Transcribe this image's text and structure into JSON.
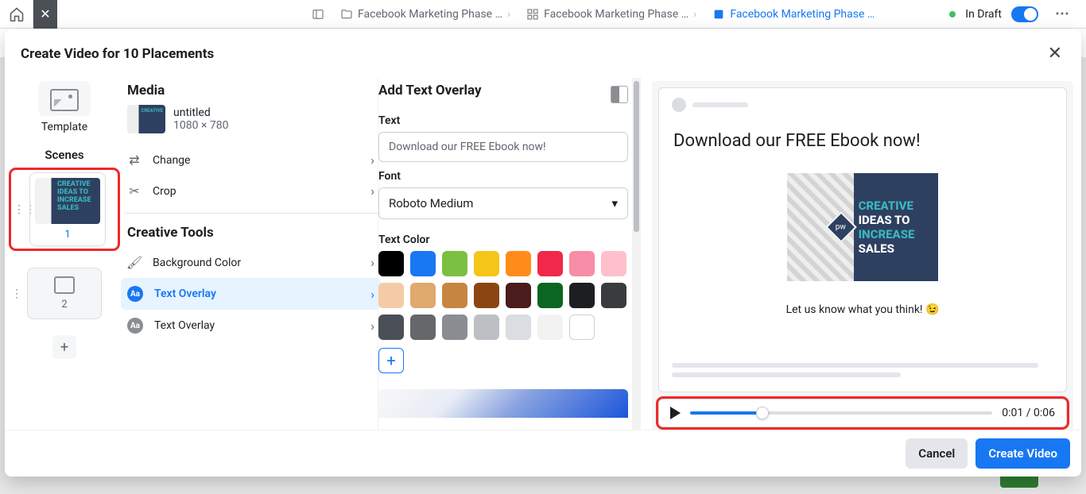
{
  "topbar": {
    "breadcrumb1": "Facebook Marketing Phase …",
    "breadcrumb2": "Facebook Marketing Phase …",
    "breadcrumb3": "Facebook Marketing Phase …",
    "subrow": "Facebook Marketing Phas…",
    "draft_label": "In Draft",
    "more": "⋯"
  },
  "modal": {
    "title": "Create Video for 10 Placements",
    "footer": {
      "cancel": "Cancel",
      "create": "Create Video"
    }
  },
  "left": {
    "template_label": "Template",
    "scenes_label": "Scenes",
    "scene1_num": "1",
    "scene2_num": "2",
    "add": "+"
  },
  "media": {
    "heading": "Media",
    "name": "untitled",
    "dims": "1080 × 780",
    "change": "Change",
    "crop": "Crop"
  },
  "tools": {
    "heading": "Creative Tools",
    "bg_color": "Background Color",
    "text_overlay": "Text Overlay",
    "text_overlay2": "Text Overlay",
    "badge": "Aa"
  },
  "form": {
    "heading": "Add Text Overlay",
    "text_lbl": "Text",
    "text_val": "Download our FREE Ebook now!",
    "font_lbl": "Font",
    "font_val": "Roboto Medium",
    "color_lbl": "Text Color",
    "colors_row1": [
      "#000000",
      "#1877f2",
      "#7bc043",
      "#f5c518",
      "#ff8c1a",
      "#f02849",
      "#f78da7",
      "#ffc0cb"
    ],
    "colors_row2": [
      "#f5cba7",
      "#e0a96d",
      "#c68642",
      "#8b4513",
      "#4a1c1c",
      "#0b6623",
      "#1c1e21",
      "#3a3b3c"
    ],
    "colors_row3": [
      "#4b4f56",
      "#65676b",
      "#8a8d91",
      "#bcc0c4",
      "#dadde1",
      "#f2f2f2",
      "#ffffff"
    ]
  },
  "preview": {
    "headline": "Download our FREE Ebook now!",
    "hero_lines": [
      "CREATIVE",
      "IDEAS TO",
      "INCREASE",
      "SALES"
    ],
    "subtext": "Let us know what you think! 😉",
    "time": "0:01 / 0:06"
  }
}
